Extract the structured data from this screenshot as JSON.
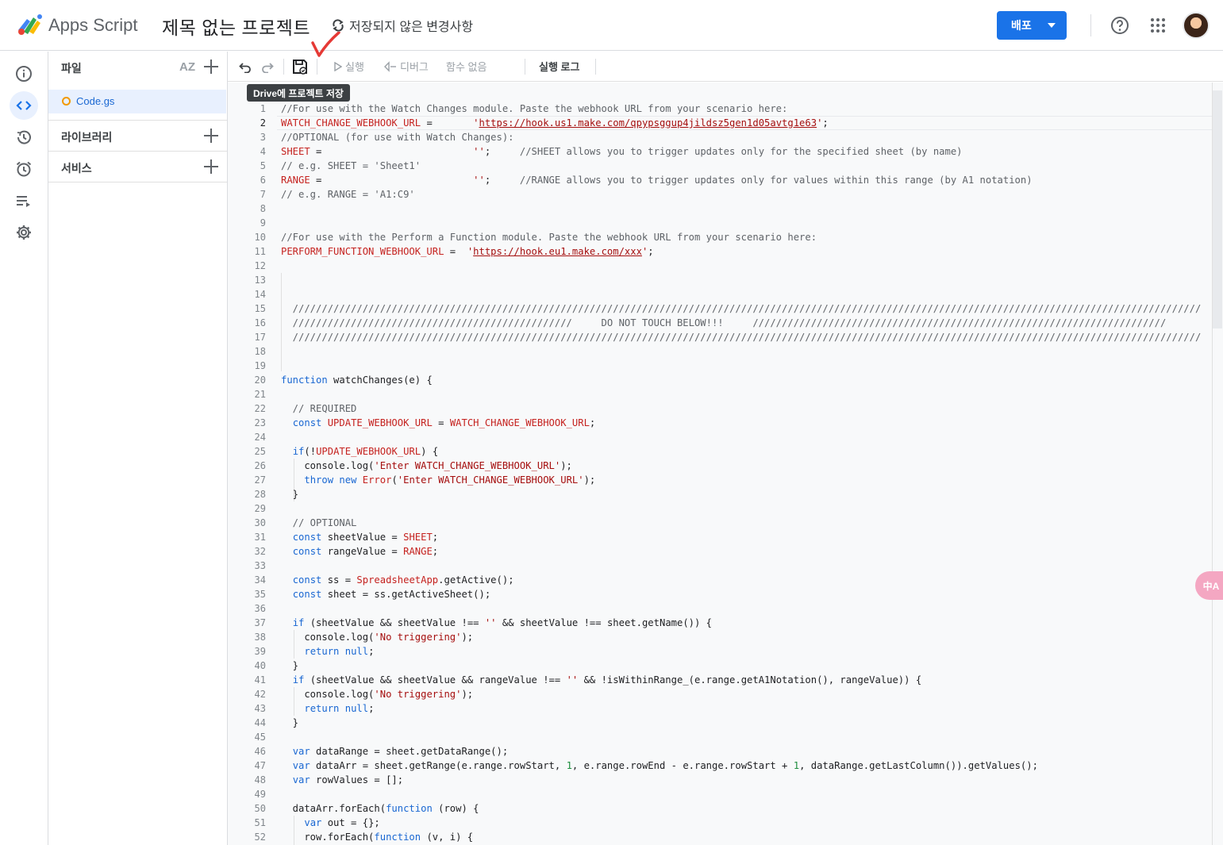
{
  "header": {
    "product_name": "Apps Script",
    "project_title": "제목 없는 프로젝트",
    "unsaved_status": "저장되지 않은 변경사항",
    "deploy_label": "배포"
  },
  "sidebar_icons": [
    "info-icon",
    "code-icon",
    "history-icon",
    "alarm-icon",
    "executions-icon",
    "settings-icon"
  ],
  "files_panel": {
    "files_title": "파일",
    "sort_label": "AZ",
    "file_name": "Code.gs",
    "libraries_title": "라이브러리",
    "services_title": "서비스"
  },
  "toolbar": {
    "run_label": "실행",
    "debug_label": "디버그",
    "function_label": "함수 없음",
    "log_label": "실행 로그",
    "save_tooltip": "Drive에 프로젝트 저장"
  },
  "editor": {
    "line_numbers": [
      "1",
      "2",
      "3",
      "4",
      "5",
      "6",
      "7",
      "8",
      "9",
      "10",
      "11",
      "12",
      "13",
      "14",
      "15",
      "16",
      "17",
      "18",
      "19",
      "20",
      "21",
      "22",
      "23",
      "24",
      "25",
      "26",
      "27",
      "28",
      "29",
      "30",
      "31",
      "32",
      "33",
      "34",
      "35",
      "36",
      "37",
      "38",
      "39",
      "40",
      "41",
      "42",
      "43",
      "44",
      "45",
      "46",
      "47",
      "48",
      "49",
      "50",
      "51",
      "52"
    ],
    "active_line": 2,
    "code_lines": [
      "//For use with the Watch Changes module. Paste the webhook URL from your scenario here:",
      "WATCH_CHANGE_WEBHOOK_URL =       'https://hook.us1.make.com/qpypsggup4jildsz5gen1d05avtg1e63';",
      "//OPTIONAL (for use with Watch Changes):",
      "SHEET =                          '';     //SHEET allows you to trigger updates only for the specified sheet (by name)",
      "// e.g. SHEET = 'Sheet1'",
      "RANGE =                          '';     //RANGE allows you to trigger updates only for values within this range (by A1 notation)",
      "// e.g. RANGE = 'A1:C9'",
      "",
      "",
      "//For use with the Perform a Function module. Paste the webhook URL from your scenario here:",
      "PERFORM_FUNCTION_WEBHOOK_URL =  'https://hook.eu1.make.com/xxx';",
      "",
      "",
      "",
      "  ////////////////////////////////////////////////////////////////////////////////////////////////////////////////////////////////////////////////////////////",
      "  ////////////////////////////////////////////////     DO NOT TOUCH BELOW!!!     ///////////////////////////////////////////////////////////////////////",
      "  ////////////////////////////////////////////////////////////////////////////////////////////////////////////////////////////////////////////////////////////",
      "",
      "",
      "function watchChanges(e) {",
      "",
      "  // REQUIRED",
      "  const UPDATE_WEBHOOK_URL = WATCH_CHANGE_WEBHOOK_URL;",
      "",
      "  if(!UPDATE_WEBHOOK_URL) {",
      "    console.log('Enter WATCH_CHANGE_WEBHOOK_URL');",
      "    throw new Error('Enter WATCH_CHANGE_WEBHOOK_URL');",
      "  }",
      "",
      "  // OPTIONAL",
      "  const sheetValue = SHEET;",
      "  const rangeValue = RANGE;",
      "",
      "  const ss = SpreadsheetApp.getActive();",
      "  const sheet = ss.getActiveSheet();",
      "",
      "  if (sheetValue && sheetValue !== '' && sheetValue !== sheet.getName()) {",
      "    console.log('No triggering');",
      "    return null;",
      "  }",
      "  if (sheetValue && sheetValue && rangeValue !== '' && !isWithinRange_(e.range.getA1Notation(), rangeValue)) {",
      "    console.log('No triggering');",
      "    return null;",
      "  }",
      "",
      "  var dataRange = sheet.getDataRange();",
      "  var dataArr = sheet.getRange(e.range.rowStart, 1, e.range.rowEnd - e.range.rowStart + 1, dataRange.getLastColumn()).getValues();",
      "  var rowValues = [];",
      "",
      "  dataArr.forEach(function (row) {",
      "    var out = {};",
      "    row.forEach(function (v, i) {"
    ]
  },
  "floating_button_label": "中A"
}
